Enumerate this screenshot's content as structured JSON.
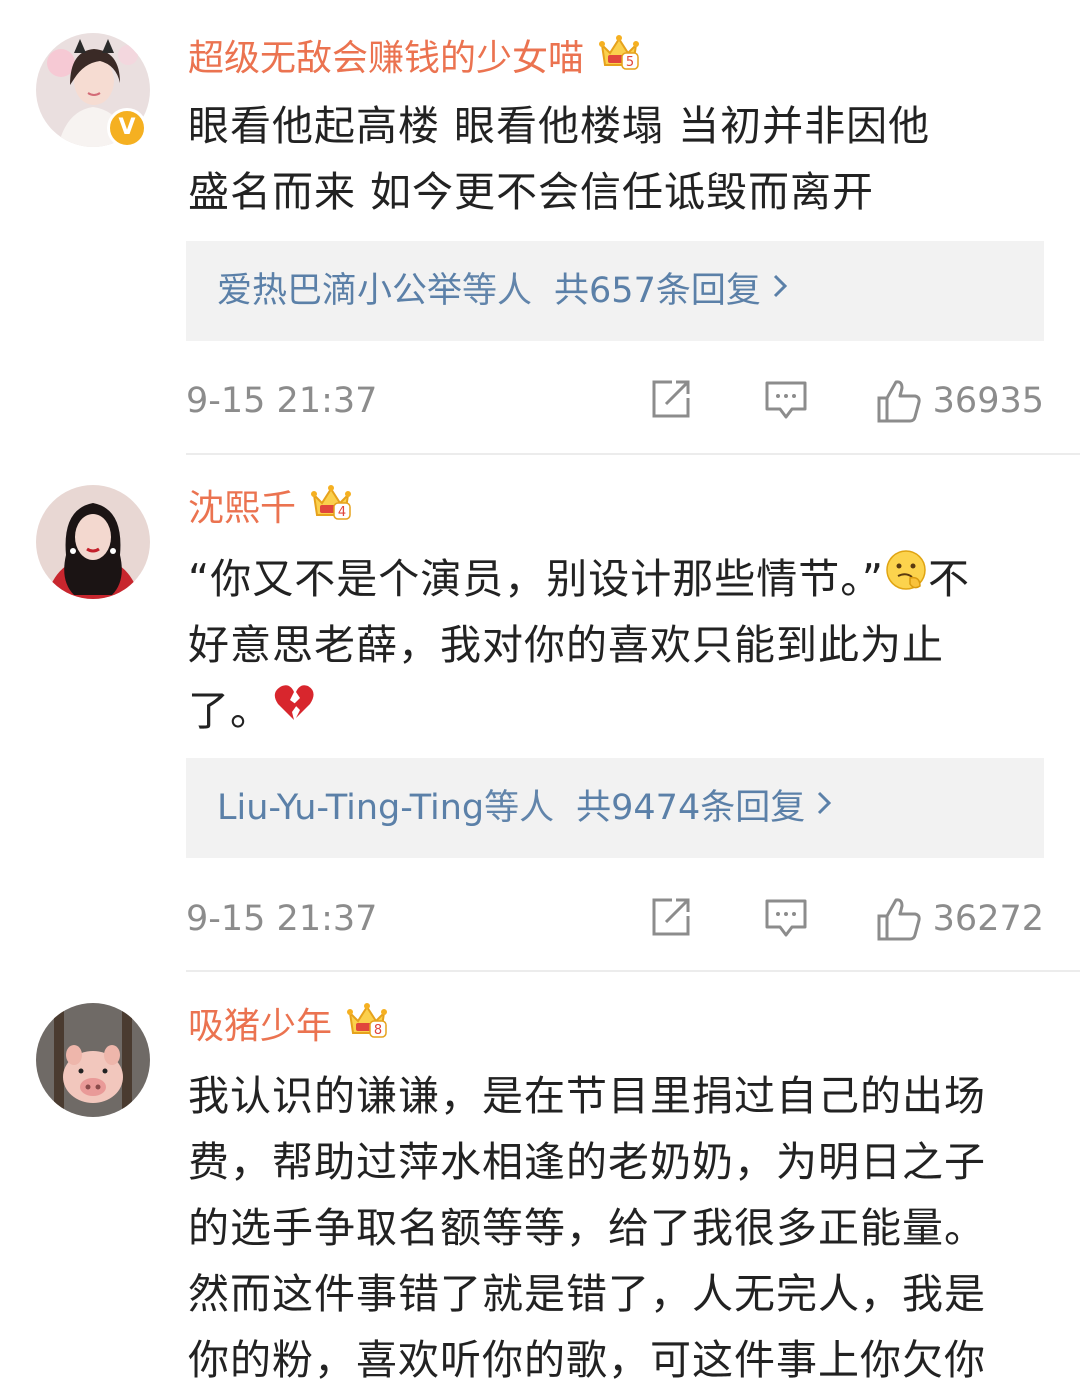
{
  "comments": [
    {
      "username": "超级无敌会赚钱的少女喵",
      "verified": true,
      "badge_number": "5",
      "content_lines": [
        "眼看他起高楼  眼看他楼塌   当初并非因他",
        "盛名而来  如今更不会信任诋毁而离开"
      ],
      "reply_users": "爱热巴滴小公举",
      "reply_mid": "等人",
      "reply_count": "共657条回复",
      "time": "9-15 21:37",
      "likes": "36935"
    },
    {
      "username": "沈熙千",
      "verified": false,
      "badge_number": "4",
      "content_lines": [
        "“你又不是个演员，别设计那些情节。”",
        "好意思老薛，我对你的喜欢只能到此为止",
        "了。"
      ],
      "line1_tail": "不",
      "reply_users": "Liu-Yu-Ting-Ting",
      "reply_mid": "等人",
      "reply_count": "共9474条回复",
      "time": "9-15 21:37",
      "likes": "36272"
    },
    {
      "username": "吸猪少年",
      "verified": false,
      "badge_number": "8",
      "content_lines": [
        "我认识的谦谦，是在节目里捐过自己的出场",
        "费，帮助过萍水相逢的老奶奶，为明日之子",
        "的选手争取名额等等，给了我很多正能量。",
        "然而这件事错了就是错了，人无完人，我是",
        "你的粉，喜欢听你的歌，可这件事上你欠你"
      ]
    }
  ],
  "icons": {
    "share": "share-icon",
    "comment": "comment-icon",
    "like": "thumbs-up-icon",
    "chevron": "chevron-right-icon",
    "crown": "vip-crown-icon",
    "verified": "verified-badge-icon"
  },
  "colors": {
    "username": "#eb7350",
    "link": "#5b80a8",
    "meta": "#8c8c8c",
    "reply_bg": "#f2f2f2"
  }
}
